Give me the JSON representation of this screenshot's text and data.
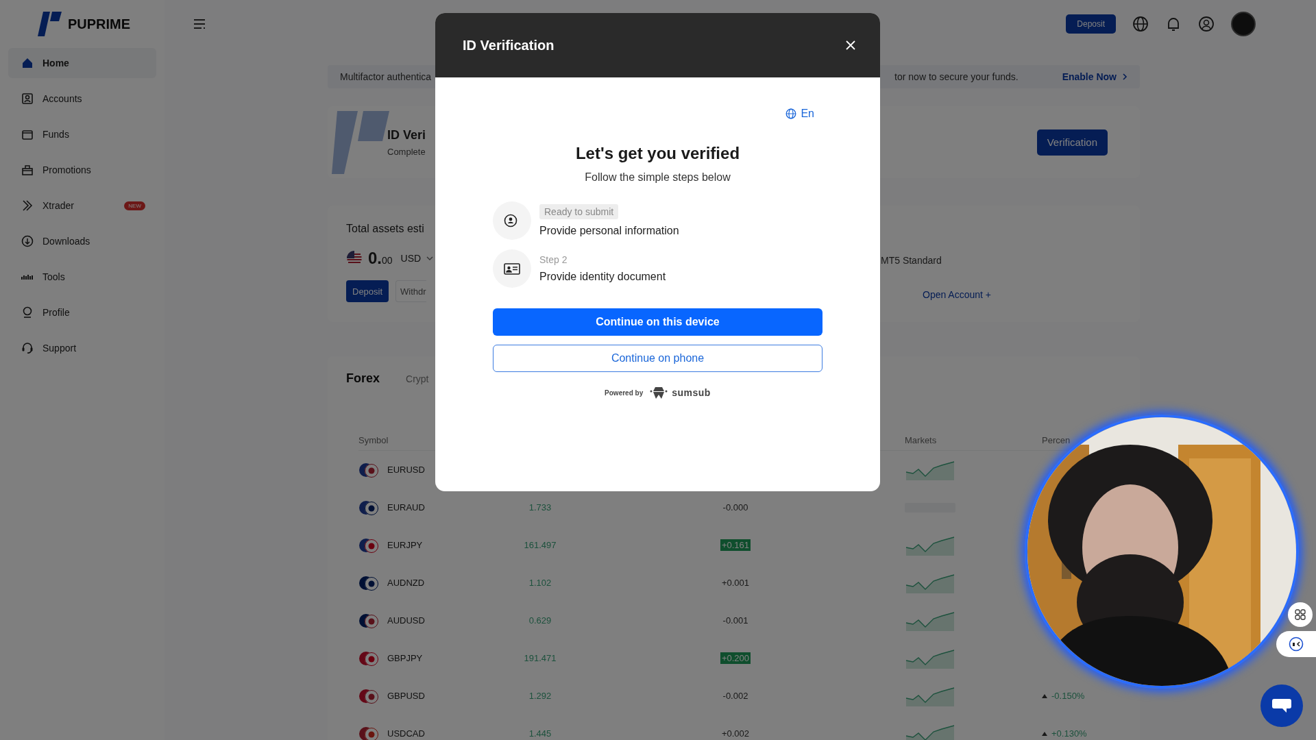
{
  "sidebar": {
    "logo_text": "PUPRIME",
    "items": [
      {
        "label": "Home",
        "selected": true
      },
      {
        "label": "Accounts",
        "selected": false
      },
      {
        "label": "Funds",
        "selected": false
      },
      {
        "label": "Promotions",
        "selected": false
      },
      {
        "label": "Xtrader",
        "selected": false,
        "badge": "NEW"
      },
      {
        "label": "Downloads",
        "selected": false
      },
      {
        "label": "Tools",
        "selected": false
      },
      {
        "label": "Profile",
        "selected": false
      },
      {
        "label": "Support",
        "selected": false
      }
    ]
  },
  "top_bar": {
    "deposit_button": "Deposit"
  },
  "banner": {
    "text_left": "Multifactor authentica",
    "text_right": "tor now to secure your funds.",
    "link": "Enable Now"
  },
  "verification_card": {
    "title": "ID Veri",
    "subtitle": "Complete",
    "button": "Verification"
  },
  "assets_card": {
    "title": "Total assets esti",
    "amount_whole": "0.",
    "amount_fraction": "00",
    "currency": "USD",
    "deposit_button": "Deposit",
    "withdraw_button": "Withdr",
    "account_type": "MT5 Standard",
    "open_account": "Open Account +"
  },
  "market_card": {
    "tabs": [
      {
        "label": "Forex",
        "selected": true
      },
      {
        "label": "Crypt",
        "selected": false
      }
    ],
    "columns": [
      "Symbol",
      "Markets",
      "Percen"
    ],
    "rows": [
      {
        "symbol": "EURUSD",
        "trend_shown": true
      },
      {
        "symbol": "EURAUD",
        "price": "1.733",
        "change": "-0.000",
        "highlighted": false,
        "trend_shown": false
      },
      {
        "symbol": "EURJPY",
        "price": "161.497",
        "change": "+0.161",
        "highlighted": true,
        "trend_shown": true
      },
      {
        "symbol": "AUDNZD",
        "price": "1.102",
        "change": "+0.001",
        "highlighted": false,
        "trend_shown": true
      },
      {
        "symbol": "AUDUSD",
        "price": "0.629",
        "change": "-0.001",
        "highlighted": false,
        "trend_shown": true
      },
      {
        "symbol": "GBPJPY",
        "price": "191.471",
        "change": "+0.200",
        "highlighted": true,
        "trend_shown": true
      },
      {
        "symbol": "GBPUSD",
        "price": "1.292",
        "change": "-0.002",
        "highlighted": false,
        "trend_shown": true,
        "percent": "-0.150%"
      },
      {
        "symbol": "USDCAD",
        "price": "1.445",
        "change": "+0.002",
        "highlighted": false,
        "trend_shown": true,
        "percent": "+0.130%"
      }
    ]
  },
  "modal": {
    "title": "ID Verification",
    "language": "En",
    "heading": "Let's get you verified",
    "subheading": "Follow the simple steps below",
    "steps": [
      {
        "kind": "badge",
        "status": "Ready to submit",
        "title": "Provide personal information"
      },
      {
        "kind": "plain",
        "status": "Step 2",
        "title": "Provide identity document"
      }
    ],
    "primary_button": "Continue on this device",
    "secondary_button": "Continue on phone",
    "powered_by": "Powered by",
    "provider": "sumsub"
  }
}
